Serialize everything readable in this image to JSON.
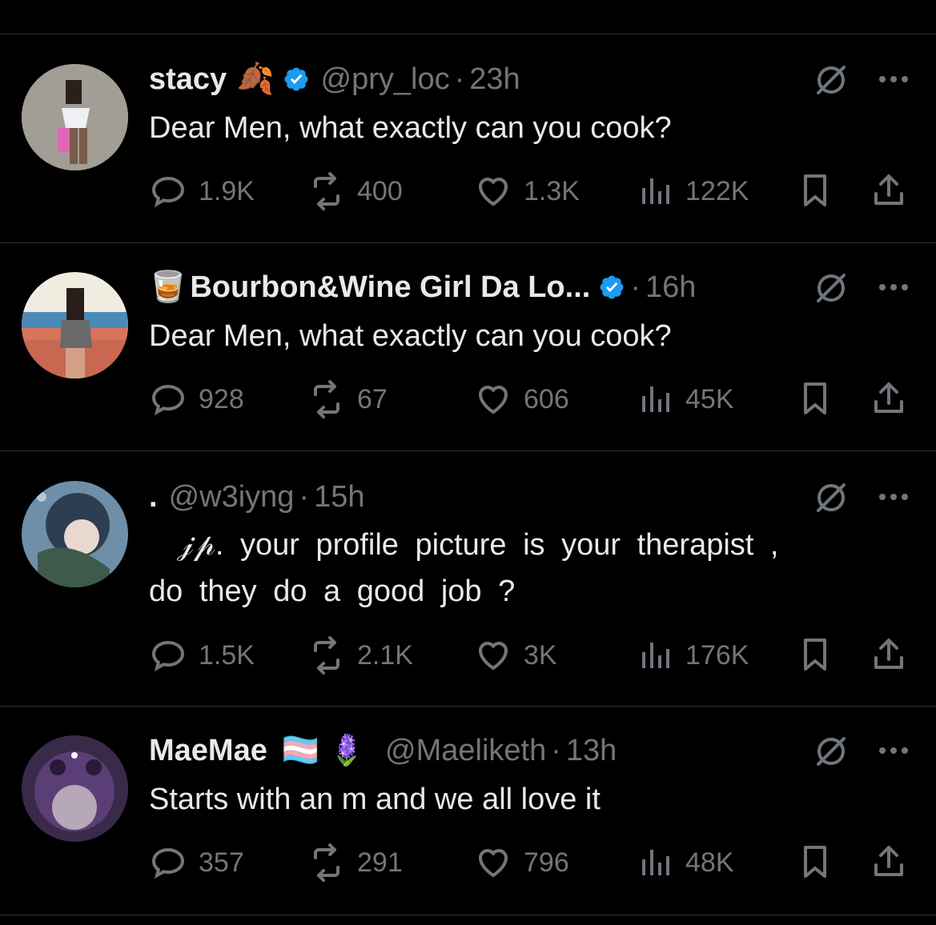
{
  "tweets": [
    {
      "name": "stacy",
      "name_emoji": "🍂",
      "verified": true,
      "handle": "@pry_loc",
      "time": "23h",
      "text_lines": [
        "Dear Men, what exactly can you cook?"
      ],
      "replies": "1.9K",
      "reposts": "400",
      "likes": "1.3K",
      "views": "122K"
    },
    {
      "name_prefix_emoji": "🥃",
      "name": "Bourbon&Wine Girl Da Lo...",
      "verified": true,
      "handle": "",
      "time": "16h",
      "text_lines": [
        "Dear Men, what exactly can you cook?"
      ],
      "replies": "928",
      "reposts": "67",
      "likes": "606",
      "views": "45K"
    },
    {
      "name": ".",
      "handle": "@w3iyng",
      "time": "15h",
      "text_lines": [
        "ㅤ𝒿𝓅. your profile picture is your therapist ,",
        "do they do a good job ?"
      ],
      "replies": "1.5K",
      "reposts": "2.1K",
      "likes": "3K",
      "views": "176K"
    },
    {
      "name": "MaeMae",
      "name_emoji": "🏳️‍⚧️ 🪻",
      "handle": "@Maeliketh",
      "time": "13h",
      "text_lines": [
        "Starts with an m and we all love it"
      ],
      "replies": "357",
      "reposts": "291",
      "likes": "796",
      "views": "48K"
    }
  ],
  "colors": {
    "background": "#000000",
    "text": "#e7e9ea",
    "secondary": "#71767b",
    "verified": "#1d9bf0",
    "divider": "#2f3336"
  },
  "icons": [
    "reply-icon",
    "repost-icon",
    "like-icon",
    "views-icon",
    "bookmark-icon",
    "share-icon",
    "grok-icon",
    "more-icon",
    "verified-badge-icon"
  ]
}
